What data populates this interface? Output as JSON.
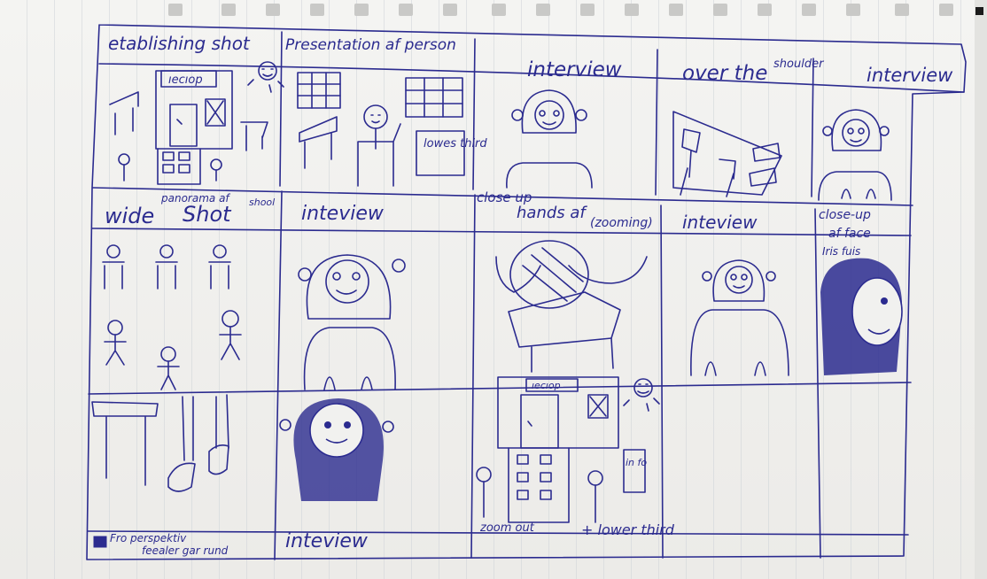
{
  "colors": {
    "ink": "#2b2b8f",
    "paper": "#f1f1ef",
    "rule_lines": "#cfd4d8"
  },
  "captions": {
    "row1": {
      "establishing": "etablishing shot",
      "presentation": "Presentation af person",
      "interview": "interview",
      "over_shoulder_a": "over the",
      "over_shoulder_b": "shoulder",
      "interview2": "interview"
    },
    "row2": {
      "wide": "wide",
      "panorama": "panorama af",
      "shot": "Shot",
      "shool": "shool",
      "interview": "inteview",
      "closeup_hands_a": "close up",
      "closeup_hands_b": "hands af",
      "closeup_hands_c": "(zooming)",
      "interview2": "inteview",
      "closeup_face_a": "close-up",
      "closeup_face_b": "af face",
      "closeup_face_c": "Iris fuis"
    },
    "row3": {
      "perspective_a": "Fro perspektiv",
      "perspective_b": "feealer gar rund",
      "interview": "inteview",
      "zoom_out": "zoom out",
      "lower_third": "+ lower third"
    }
  },
  "sketch_text": {
    "sign_top": "ıecıop",
    "sign_bottom": "ıecıop",
    "lower_third": "lowes third",
    "info": "in fo"
  }
}
